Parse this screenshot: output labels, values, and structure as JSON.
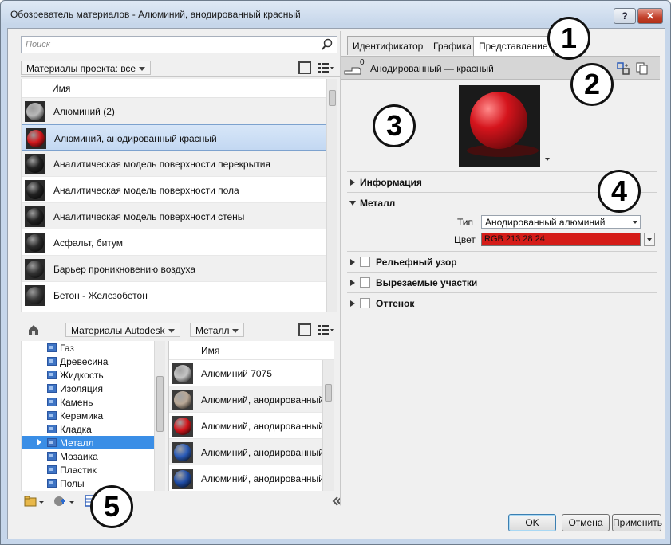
{
  "window": {
    "title": "Обозреватель материалов - Алюминий, анодированный красный",
    "help_label": "?",
    "close_label": "✕"
  },
  "search": {
    "placeholder": "Поиск"
  },
  "project": {
    "filter_label": "Материалы проекта: все",
    "column_name": "Имя",
    "items": [
      {
        "label": "Алюминий (2)",
        "swatch": "#b8b8b8"
      },
      {
        "label": "Алюминий, анодированный красный",
        "swatch": "#d4161c"
      },
      {
        "label": "Аналитическая модель поверхности перекрытия",
        "swatch": "#222222"
      },
      {
        "label": "Аналитическая модель поверхности пола",
        "swatch": "#222222"
      },
      {
        "label": "Аналитическая модель поверхности стены",
        "swatch": "#222222"
      },
      {
        "label": "Асфальт, битум",
        "swatch": "#2b2b2b"
      },
      {
        "label": "Барьер проникновению воздуха",
        "swatch": "#333333"
      },
      {
        "label": "Бетон - Железобетон",
        "swatch": "#3a3a3a"
      }
    ]
  },
  "library": {
    "crumb_library": "Материалы Autodesk",
    "crumb_category": "Металл",
    "column_name": "Имя",
    "tree": [
      "Газ",
      "Древесина",
      "Жидкость",
      "Изоляция",
      "Камень",
      "Керамика",
      "Кладка",
      "Металл",
      "Мозаика",
      "Пластик",
      "Полы"
    ],
    "items": [
      {
        "label": "Алюминий 7075",
        "swatch": "#c4c4c4"
      },
      {
        "label": "Алюминий, анодированный б",
        "swatch": "#b9a896"
      },
      {
        "label": "Алюминий, анодированный к",
        "swatch": "#d4161c"
      },
      {
        "label": "Алюминий, анодированный с",
        "swatch": "#2a5bb8"
      },
      {
        "label": "Алюминий, анодированный с",
        "swatch": "#1f4da8"
      }
    ]
  },
  "editor": {
    "tabs": [
      "Идентификатор",
      "Графика",
      "Представление"
    ],
    "asset_count": "0",
    "asset_name": "Анодированный — красный",
    "sections": {
      "info": "Информация",
      "metal": "Металл",
      "relief": "Рельефный узор",
      "cutouts": "Вырезаемые участки",
      "tint": "Оттенок"
    },
    "type_label": "Тип",
    "type_value": "Анодированный алюминий",
    "color_label": "Цвет",
    "color_value": "RGB 213 28 24",
    "color_hex": "#d51c18"
  },
  "buttons": {
    "ok": "OK",
    "cancel": "Отмена",
    "apply": "Применить"
  },
  "callouts": [
    "1",
    "2",
    "3",
    "4",
    "5"
  ]
}
